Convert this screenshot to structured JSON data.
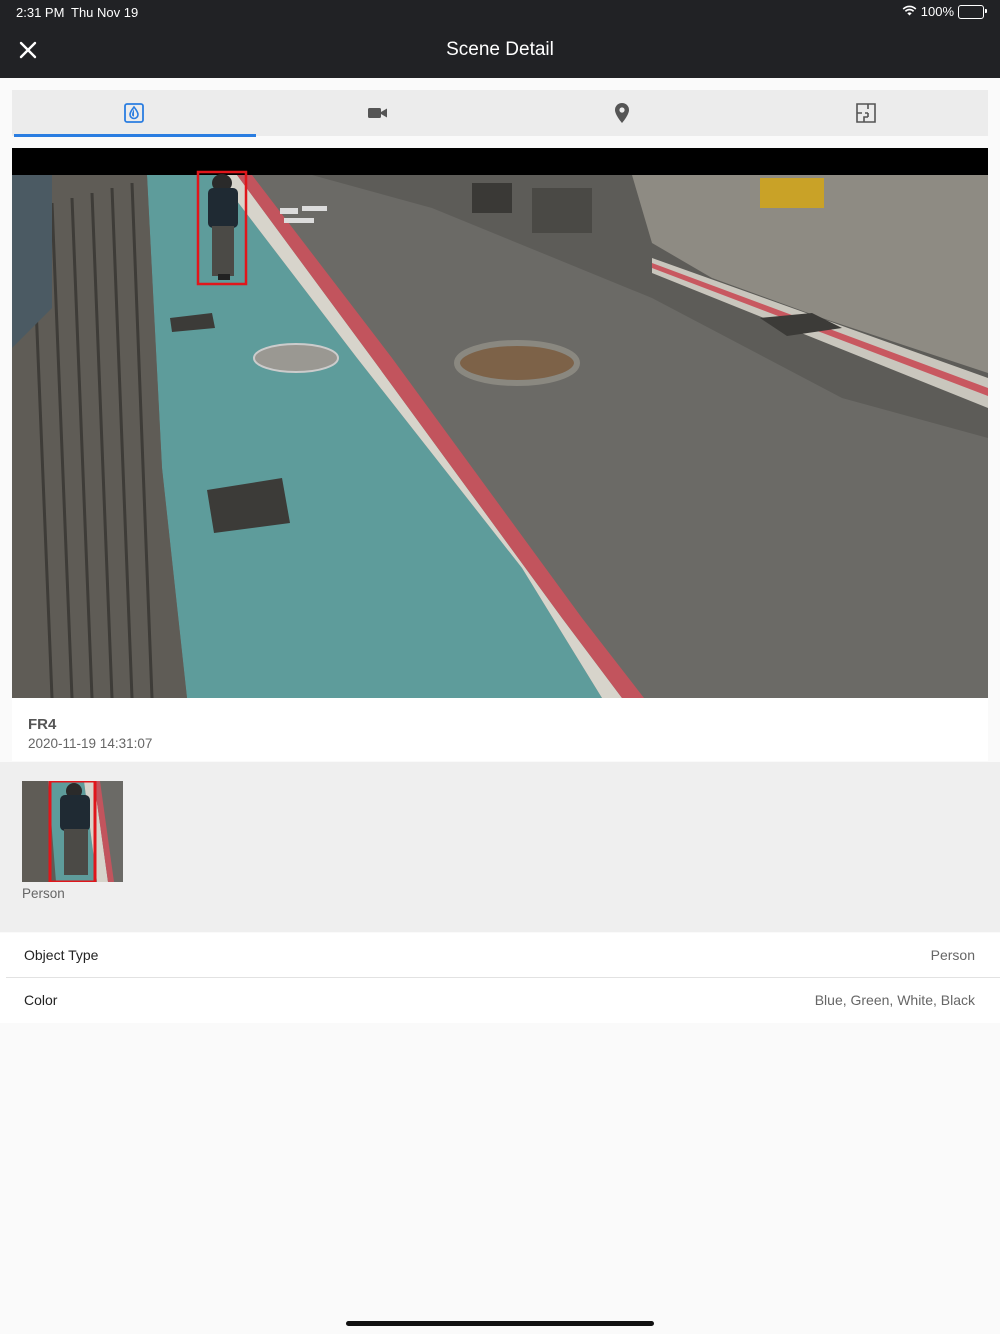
{
  "status_bar": {
    "time": "2:31 PM",
    "date": "Thu Nov 19",
    "battery": "100%"
  },
  "nav": {
    "title": "Scene Detail"
  },
  "tabs": [
    {
      "icon": "water-drop-icon",
      "active": true
    },
    {
      "icon": "video-camera-icon",
      "active": false
    },
    {
      "icon": "location-pin-icon",
      "active": false
    },
    {
      "icon": "floor-plan-icon",
      "active": false
    }
  ],
  "scene": {
    "camera_name": "FR4",
    "timestamp": "2020-11-19 14:31:07"
  },
  "thumbnail": {
    "label": "Person"
  },
  "attributes": {
    "object_type": {
      "label": "Object Type",
      "value": "Person"
    },
    "color": {
      "label": "Color",
      "value": "Blue, Green, White, Black"
    }
  },
  "colors": {
    "accent": "#2a7de1",
    "nav_bg": "#212225",
    "bbox": "#e0161b"
  }
}
